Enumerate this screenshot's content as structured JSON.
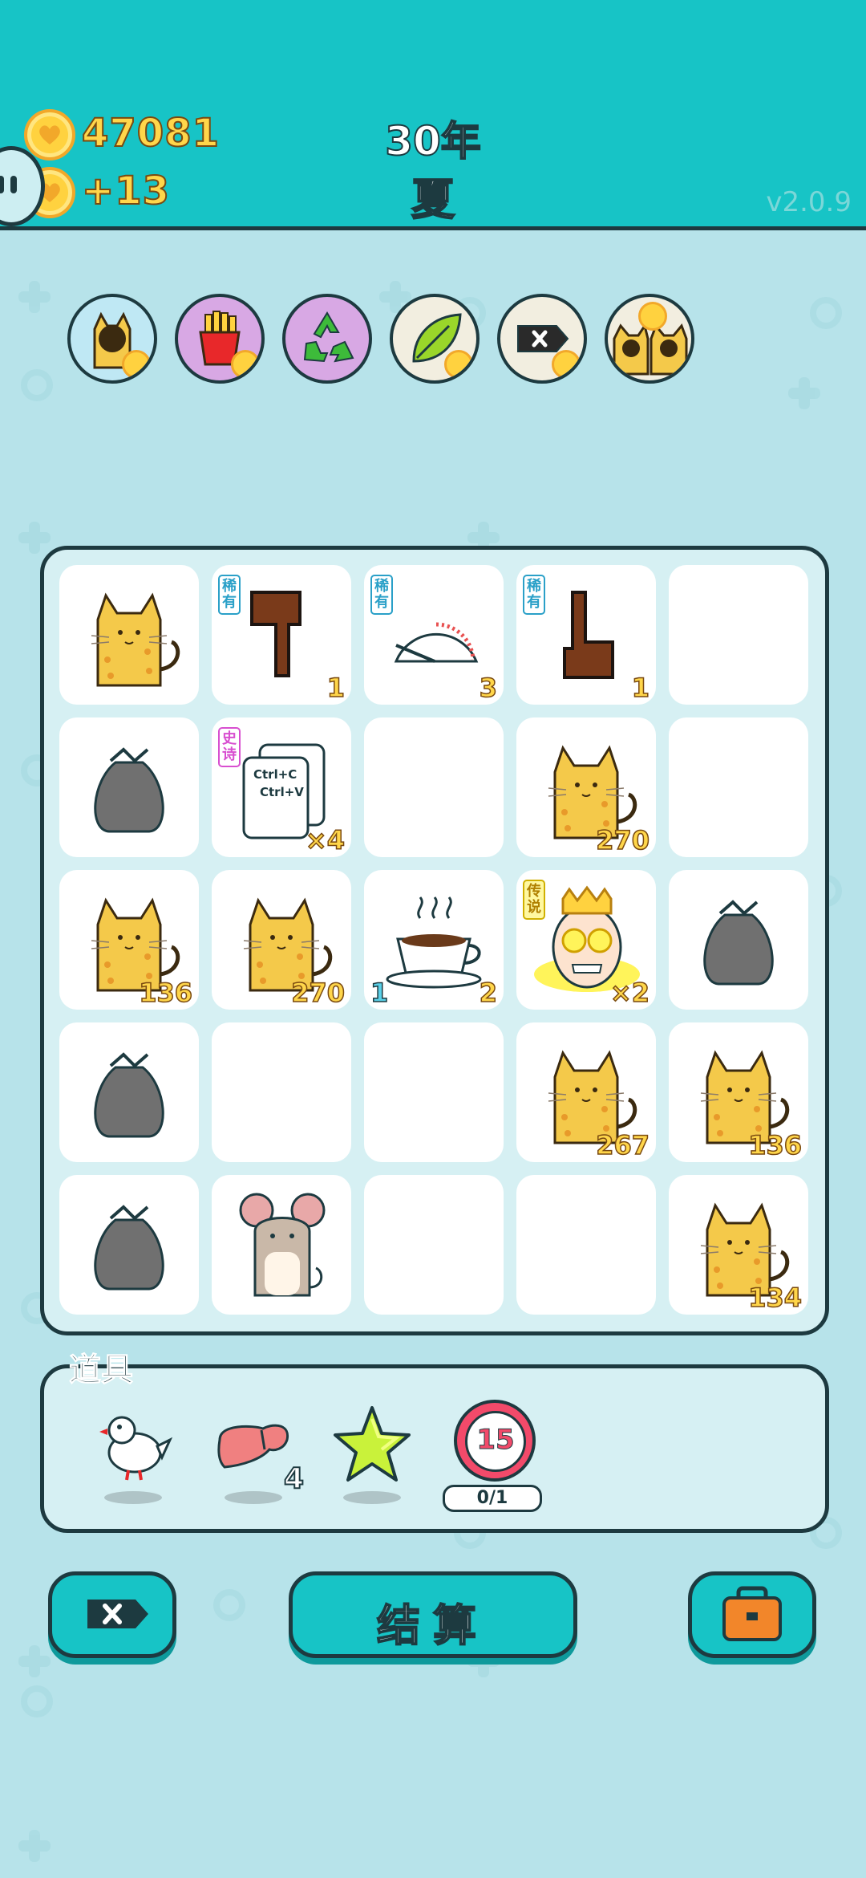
{
  "header": {
    "coins": "47081",
    "coin_rate": "+13",
    "year": "30年",
    "season": "夏",
    "version": "v2.0.9"
  },
  "buffs": [
    {
      "name": "cat-buff-icon"
    },
    {
      "name": "fries-buff-icon"
    },
    {
      "name": "recycle-buff-icon"
    },
    {
      "name": "leaf-buff-icon"
    },
    {
      "name": "remove-tag-buff-icon"
    },
    {
      "name": "owl-cats-buff-icon"
    }
  ],
  "board": {
    "cells": [
      {
        "item": "cat",
        "count": ""
      },
      {
        "item": "pointing-down-hand",
        "tag": "稀有",
        "count": "1"
      },
      {
        "item": "speedometer",
        "tag": "稀有",
        "count": "3"
      },
      {
        "item": "pointing-up-hand",
        "tag": "稀有",
        "count": "1"
      },
      {
        "item": "empty"
      },
      {
        "item": "trash-bag"
      },
      {
        "item": "ctrl-c-ctrl-v",
        "tag": "史诗",
        "count": "×4",
        "text1": "Ctrl+C",
        "text2": "Ctrl+V"
      },
      {
        "item": "empty"
      },
      {
        "item": "cat",
        "count": "270"
      },
      {
        "item": "empty"
      },
      {
        "item": "cat",
        "count": "136"
      },
      {
        "item": "cat",
        "count": "270"
      },
      {
        "item": "coffee",
        "count_left": "1",
        "count": "2"
      },
      {
        "item": "king",
        "tag": "传说",
        "count": "×2"
      },
      {
        "item": "trash-bag"
      },
      {
        "item": "trash-bag"
      },
      {
        "item": "empty"
      },
      {
        "item": "empty"
      },
      {
        "item": "cat",
        "count": "267"
      },
      {
        "item": "cat",
        "count": "136"
      },
      {
        "item": "trash-bag"
      },
      {
        "item": "mouse"
      },
      {
        "item": "empty"
      },
      {
        "item": "empty"
      },
      {
        "item": "cat",
        "count": "134"
      }
    ]
  },
  "items": {
    "title": "道具",
    "list": [
      {
        "name": "dove",
        "count": ""
      },
      {
        "name": "liver",
        "count": "4"
      },
      {
        "name": "star",
        "count": ""
      },
      {
        "name": "timer",
        "value": "15",
        "progress": "0/1"
      }
    ]
  },
  "actions": {
    "remove_label": "",
    "settle_label": "结算",
    "bag_label": ""
  },
  "colors": {
    "header": "#17c4c6",
    "background": "#b7e3ea",
    "outline": "#1d3a40",
    "gold": "#ffd64a"
  }
}
